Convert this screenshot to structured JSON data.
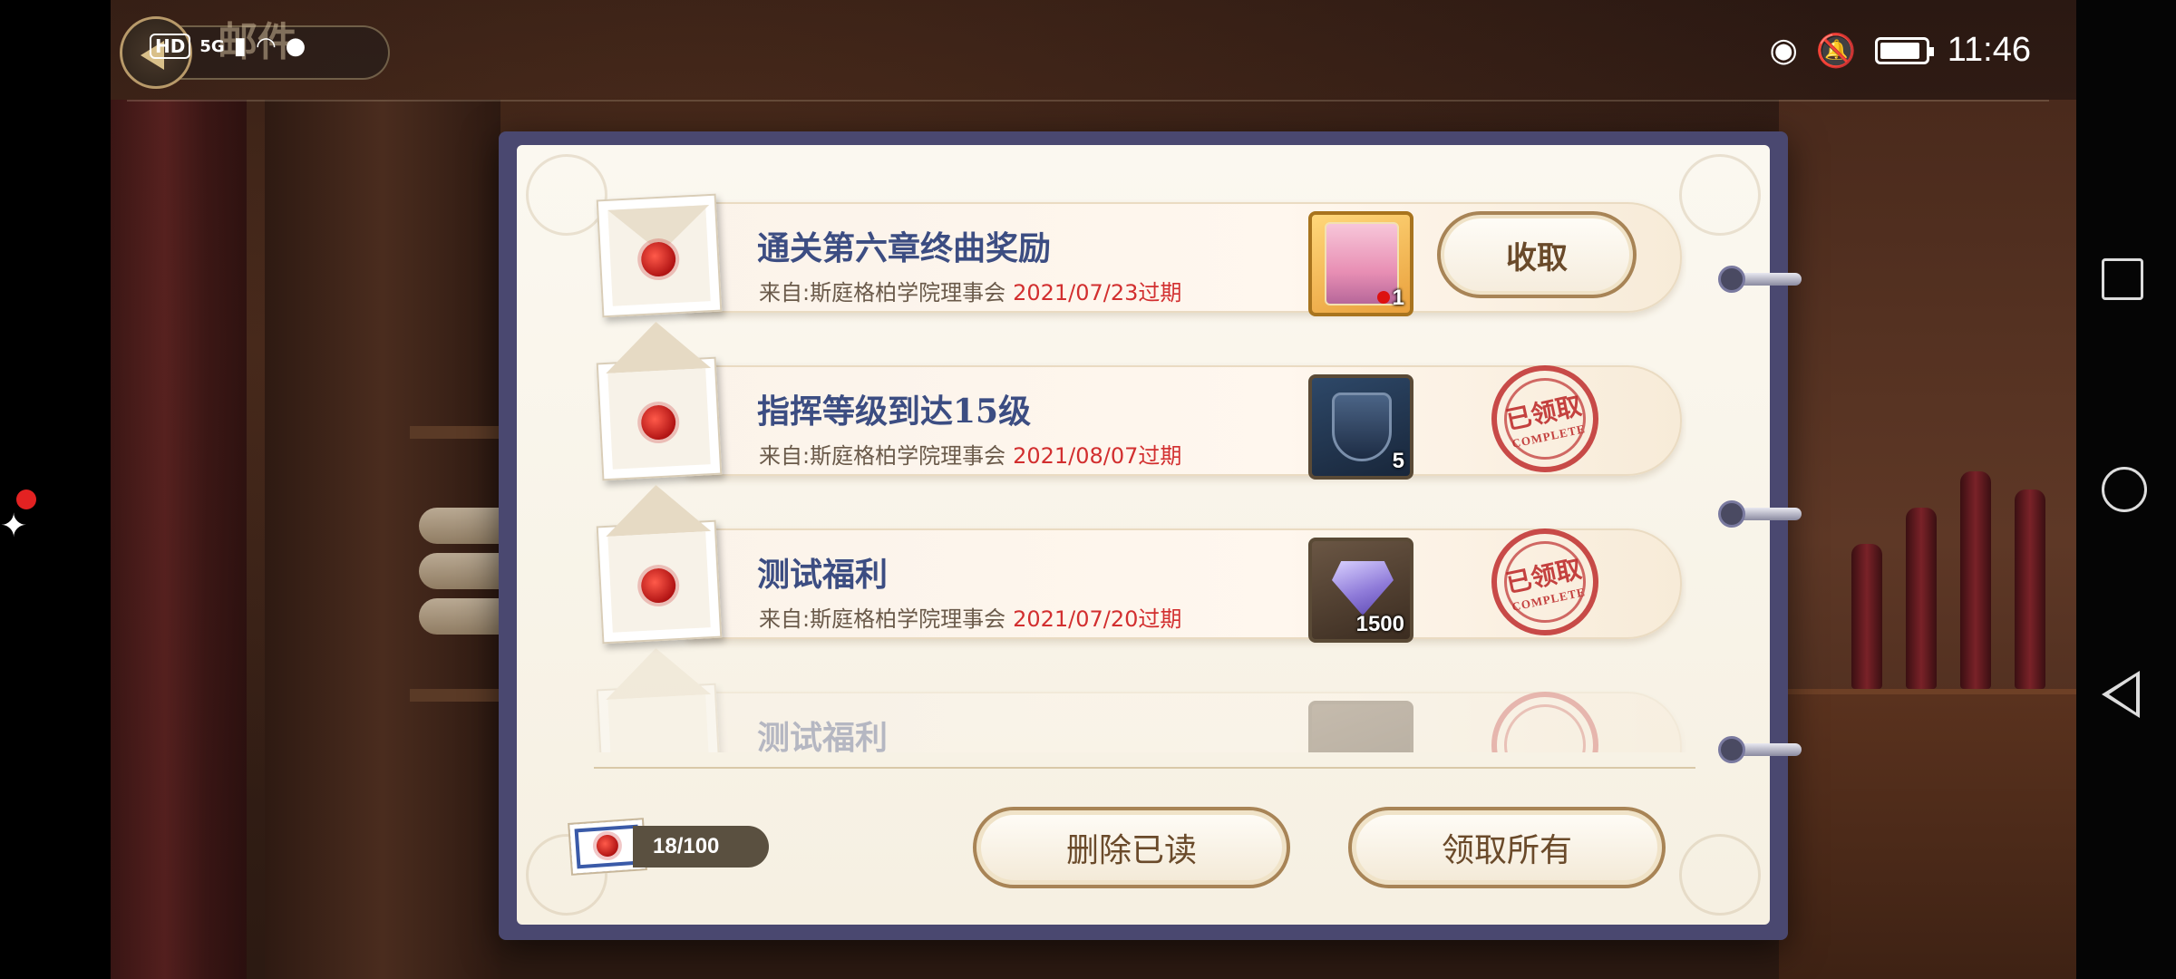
{
  "status_bar": {
    "hd": "HD",
    "network": "5G",
    "time": "11:46"
  },
  "screen": {
    "title": "邮件"
  },
  "mails": [
    {
      "title": "通关第六章终曲奖励",
      "from": "来自:斯庭格柏学院理事会",
      "expire": "2021/07/23过期",
      "item_icon": "character-card-icon",
      "item_count": "1",
      "state": "unclaimed",
      "action_label": "收取"
    },
    {
      "title": "指挥等级到达15级",
      "from": "来自:斯庭格柏学院理事会",
      "expire": "2021/08/07过期",
      "item_icon": "shield-emblem-icon",
      "item_count": "5",
      "state": "claimed",
      "stamp_cn": "已领取",
      "stamp_en": "COMPLETE"
    },
    {
      "title": "测试福利",
      "from": "来自:斯庭格柏学院理事会",
      "expire": "2021/07/20过期",
      "item_icon": "diamond-gem-icon",
      "item_count": "1500",
      "state": "claimed",
      "stamp_cn": "已领取",
      "stamp_en": "COMPLETE"
    },
    {
      "title": "测试福利",
      "item_icon": "item-icon",
      "state": "claimed"
    }
  ],
  "footer": {
    "mail_count": "18/100",
    "delete_read_label": "删除已读",
    "claim_all_label": "领取所有"
  },
  "colors": {
    "title_blue": "#3c4d82",
    "expire_red": "#d22f2f",
    "stamp_red": "#be2d2d",
    "frame_purple": "#4a4870"
  }
}
